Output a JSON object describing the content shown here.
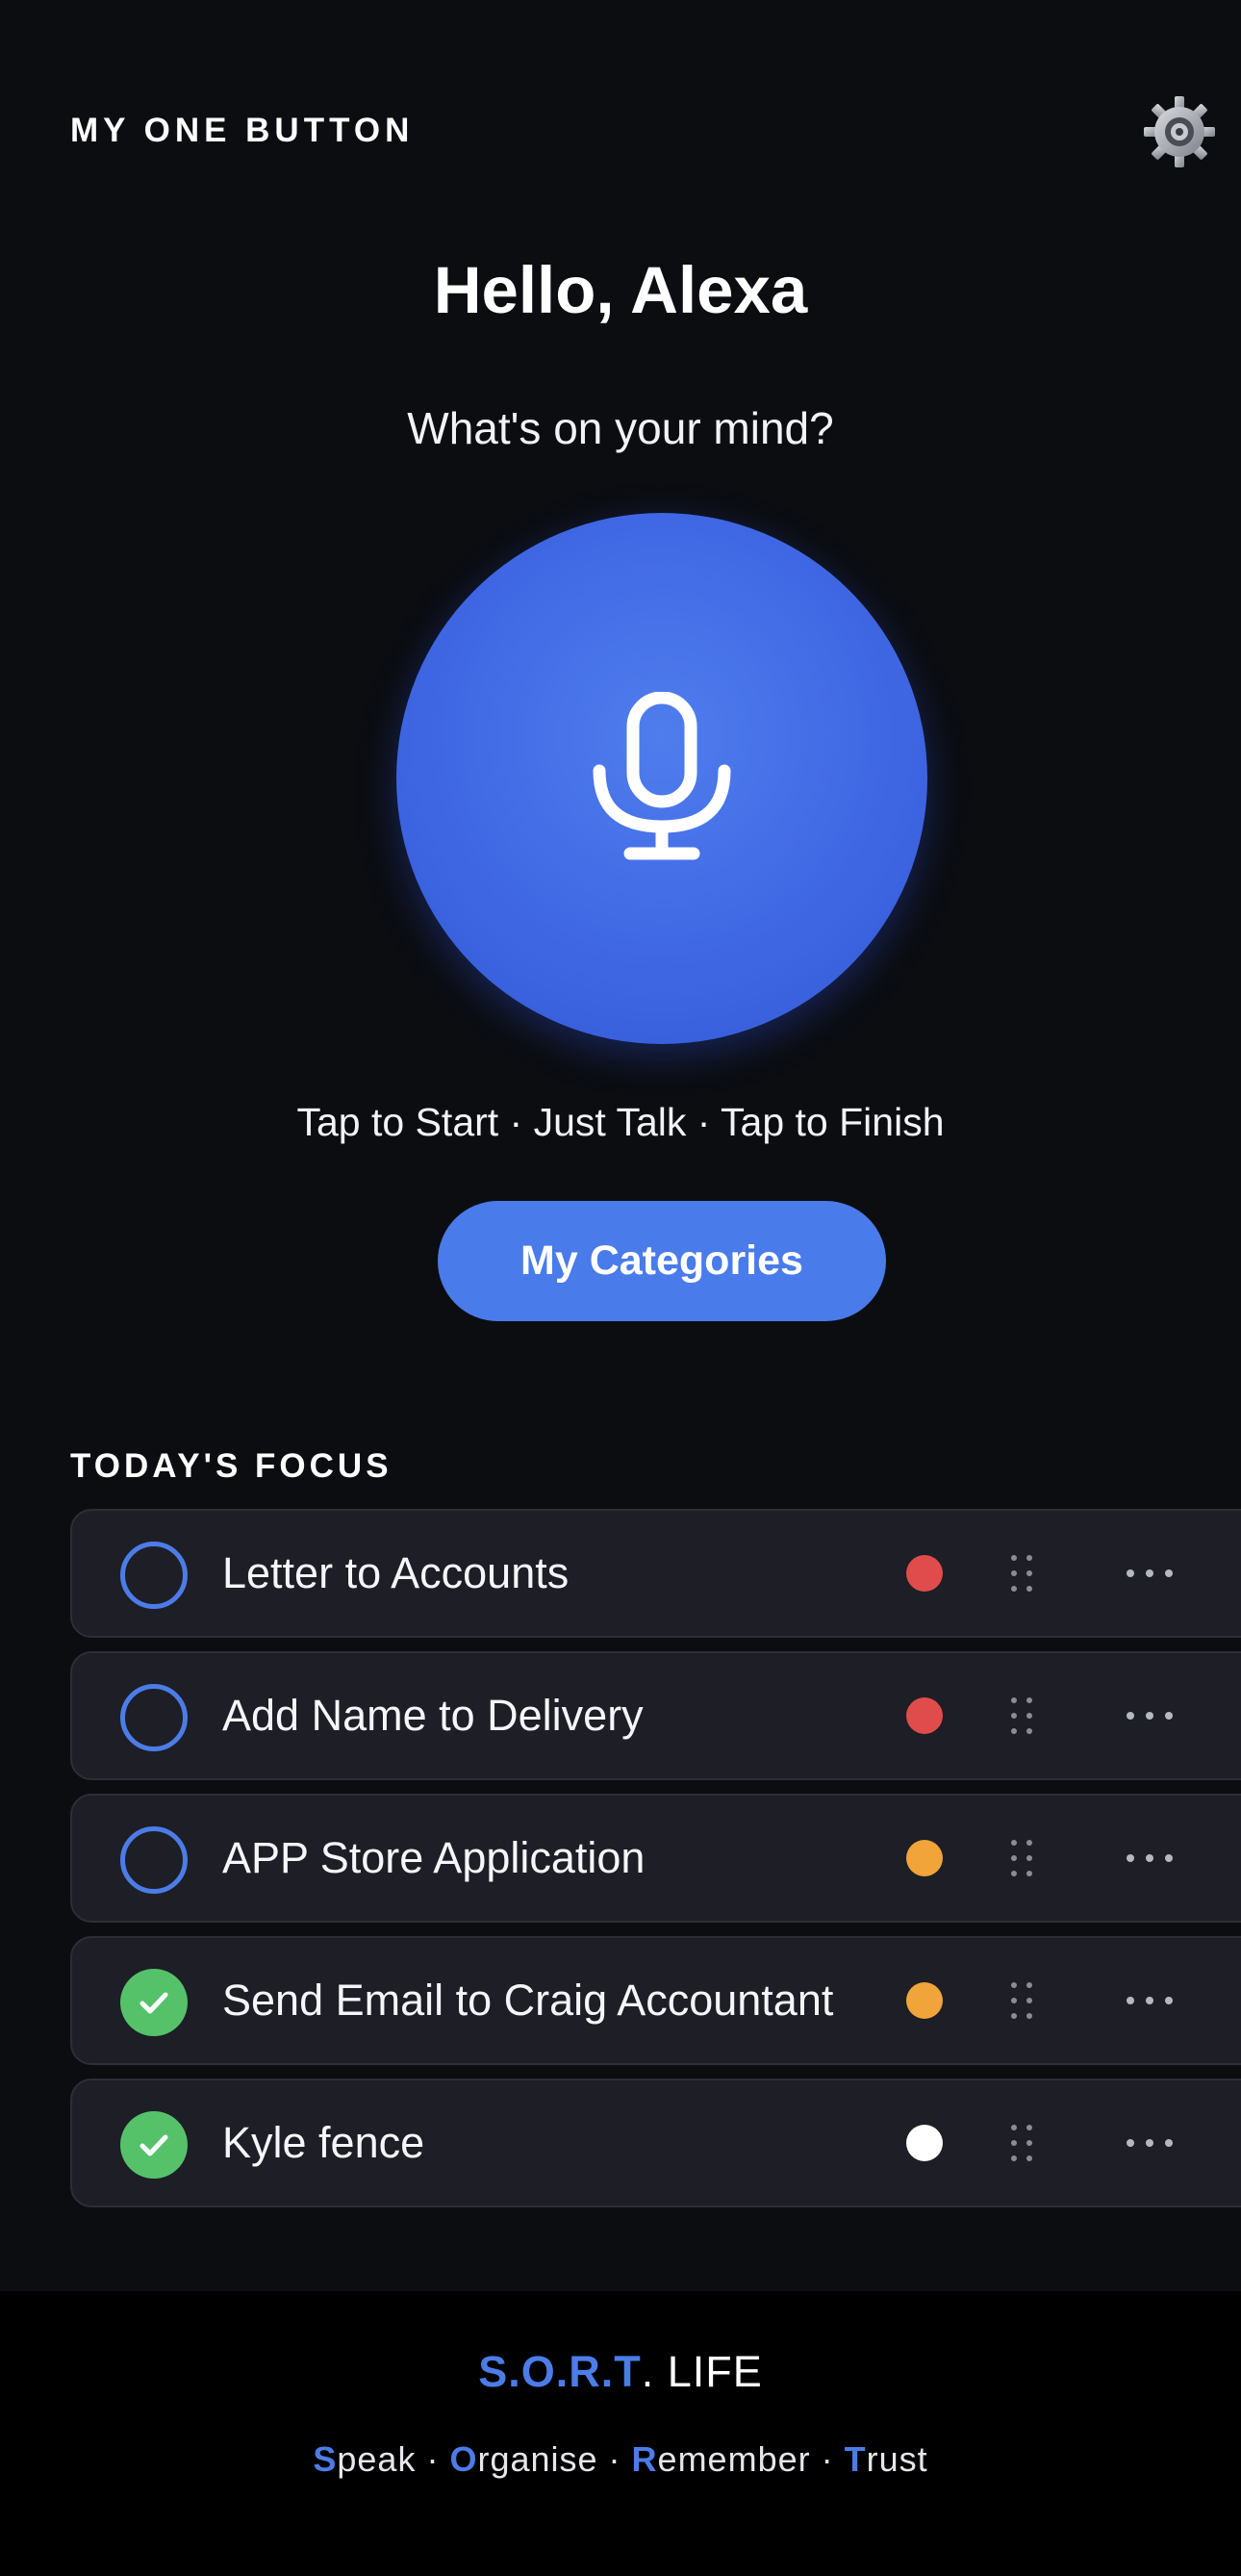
{
  "header": {
    "app_title": "MY ONE BUTTON",
    "settings_icon": "gear-icon"
  },
  "main": {
    "greeting": "Hello, Alexa",
    "prompt": "What's on your mind?",
    "mic_icon": "microphone-icon",
    "hint": "Tap to Start · Just Talk · Tap to Finish",
    "categories_label": "My Categories"
  },
  "focus": {
    "title": "TODAY'S FOCUS",
    "tasks": [
      {
        "label": "Letter to Accounts",
        "done": false,
        "priority_color": "#e04c4c"
      },
      {
        "label": "Add Name to Delivery",
        "done": false,
        "priority_color": "#e04c4c"
      },
      {
        "label": "APP Store Application",
        "done": false,
        "priority_color": "#f0a43a"
      },
      {
        "label": "Send Email to Craig Accountant",
        "done": true,
        "priority_color": "#f0a43a"
      },
      {
        "label": "Kyle fence",
        "done": true,
        "priority_color": "#ffffff"
      }
    ]
  },
  "footer": {
    "brand": {
      "s": "S",
      "dot1": ".",
      "o": "O",
      "dot2": ".",
      "r": "R",
      "dot3": ".",
      "t": "T",
      "rest": ". LIFE"
    },
    "tagline": [
      {
        "initial": "S",
        "rest": "peak"
      },
      {
        "initial": "O",
        "rest": "rganise"
      },
      {
        "initial": "R",
        "rest": "emember"
      },
      {
        "initial": "T",
        "rest": "rust"
      }
    ],
    "separator": " · "
  },
  "colors": {
    "background": "#0c0d11",
    "accent": "#4c7ce8",
    "card": "#1d1e26",
    "done": "#55c26a"
  }
}
